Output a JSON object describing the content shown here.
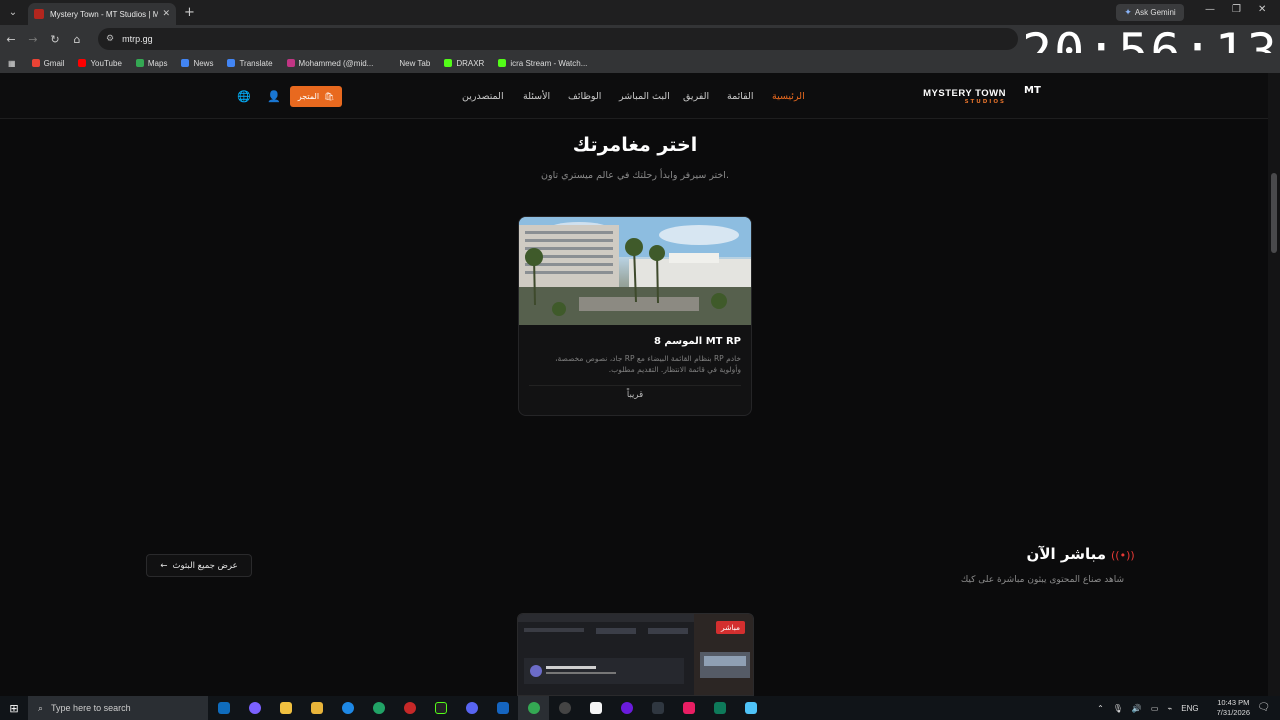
{
  "browser": {
    "tab_title": "Mystery Town - MT Studios | M",
    "ask_gemini": "Ask Gemini",
    "url": "mtrp.gg",
    "clock": "20:56:13",
    "bookmarks": [
      {
        "label": "Gmail",
        "color": "#ea4335"
      },
      {
        "label": "YouTube",
        "color": "#ff0000"
      },
      {
        "label": "Maps",
        "color": "#34a853"
      },
      {
        "label": "News",
        "color": "#4285f4"
      },
      {
        "label": "Translate",
        "color": "#4285f4"
      },
      {
        "label": "Mohammed (@mid...",
        "color": "#c13584"
      },
      {
        "label": "New Tab",
        "color": "#333436"
      },
      {
        "label": "DRAXR",
        "color": "#53fc18"
      },
      {
        "label": "icra Stream - Watch...",
        "color": "#53fc18"
      }
    ]
  },
  "site": {
    "logo_mt": "MT",
    "logo_name": "MYSTERY TOWN",
    "logo_studios": "STUDIOS",
    "nav": {
      "home": "الرئيسية",
      "list": "القائمة",
      "team": "الفريق",
      "live": "البث المباشر",
      "jobs": "الوظائف",
      "faq": "الأسئلة",
      "leaders": "المتصدرين"
    },
    "store": "المتجر",
    "accent": "#e8691f"
  },
  "adventure": {
    "title": "اختر مغامرتك",
    "subtitle": "اختر سيرفر وابدأ رحلتك في عالم ميستري تاون.",
    "card": {
      "title": "MT RP الموسم 8",
      "description": "خادم RP بنظام القائمة البيضاء مع RP جاد، نصوص مخصصة، وأولوية في قائمة الانتظار. التقديم مطلوب.",
      "status": "قريباً"
    }
  },
  "live": {
    "title": "مباشر الآن",
    "subtitle": "شاهد صناع المحتوى يبثون مباشرة على كيك",
    "view_all": "عرض جميع البثوث",
    "badge": "مباشر"
  },
  "taskbar": {
    "search_placeholder": "Type here to search",
    "lang": "ENG",
    "time": "10:43 PM",
    "date": "7/31/2026"
  }
}
